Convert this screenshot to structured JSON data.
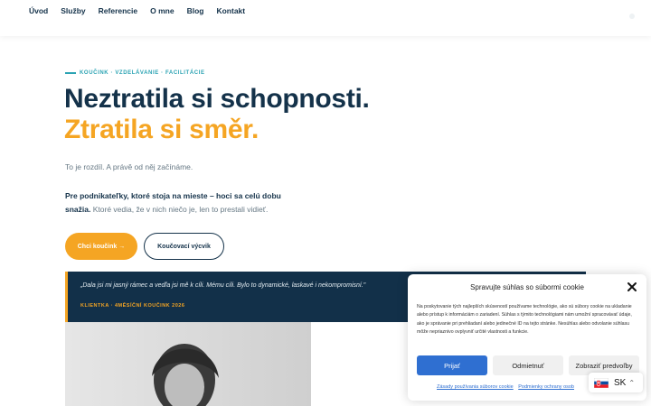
{
  "nav": {
    "items": [
      "Úvod",
      "Služby",
      "Referencie",
      "O mne",
      "Blog",
      "Kontakt"
    ]
  },
  "hero": {
    "eyebrow": "KOUČINK · VZDELÁVANIE · FACILITÁCIE",
    "headline_1": "Neztratila si schopnosti.",
    "headline_2": "Ztratila si směr.",
    "lead": "To je rozdíl. A právě od něj začínáme.",
    "para_bold": "Pre podnikateľky, ktoré stoja na mieste – hoci sa celú dobu snažia.",
    "para_rest": "Ktoré vedia, že v nich niečo je, len to prestali vidieť.",
    "cta_primary": "Chci koučink →",
    "cta_secondary": "Koučovací výcvik"
  },
  "quote": {
    "text": "„Dala jsi mi jasný rámec a vedľa jsi mě k cíli. Mému cíli. Bylo to dynamické, laskavé i nekompromisní.\"",
    "author": "KLIENTKA · 4MĚSÍČNÍ KOUČINK 2026"
  },
  "cookie": {
    "title": "Spravujte súhlas so súbormi cookie",
    "body": "Na poskytovanie tých najlepších skúseností používame technológie, ako sú súbory cookie na ukladanie alebo prístup k informáciám o zariadení. Súhlas s týmito technológiami nám umožní spracovávať údaje, ako je správanie pri prehliadaní alebo jedinečné ID na tejto stránke. Nesúhlas alebo odvolanie súhlasu môže nepriaznivo ovplyvniť určité vlastnosti a funkcie.",
    "accept": "Prijať",
    "deny": "Odmietnuť",
    "prefs": "Zobraziť predvoľby",
    "link_1": "Zásady používania súborov cookie",
    "link_2": "Podmienky ochrany osob"
  },
  "lang": {
    "label": "SK",
    "flag": "slovakia-flag-icon"
  },
  "colors": {
    "navy": "#14324a",
    "accent": "#f5a523",
    "teal": "#2ba3b3",
    "blue": "#2f6fd1"
  }
}
